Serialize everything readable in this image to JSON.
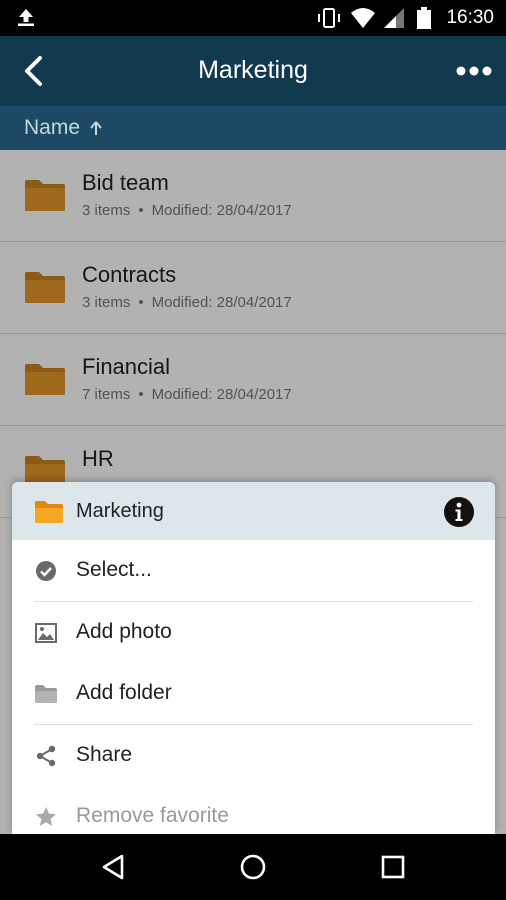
{
  "status_bar": {
    "time": "16:30",
    "icons": [
      "upload-icon",
      "vibrate-icon",
      "wifi-icon",
      "signal-icon",
      "battery-icon"
    ]
  },
  "app_bar": {
    "title": "Marketing",
    "back_icon": "chevron-left-icon",
    "more_icon": "more-horizontal-icon"
  },
  "sort_bar": {
    "label": "Name",
    "direction_icon": "arrow-up-icon"
  },
  "folders": [
    {
      "name": "Bid team",
      "count": "3 items",
      "modified": "Modified: 28/04/2017"
    },
    {
      "name": "Contracts",
      "count": "3 items",
      "modified": "Modified: 28/04/2017"
    },
    {
      "name": "Financial",
      "count": "7 items",
      "modified": "Modified: 28/04/2017"
    },
    {
      "name": "HR",
      "count": "",
      "modified": ""
    }
  ],
  "sheet": {
    "title": "Marketing",
    "items": [
      {
        "label": "Select...",
        "icon": "check-circle-icon"
      },
      {
        "label": "Add photo",
        "icon": "image-icon"
      },
      {
        "label": "Add folder",
        "icon": "folder-icon"
      },
      {
        "label": "Share",
        "icon": "share-icon"
      },
      {
        "label": "Remove favorite",
        "icon": "star-icon"
      }
    ]
  },
  "colors": {
    "app_bar": "#113a4e",
    "sort_bar": "#1c4a64",
    "folder": "#c8811e",
    "sheet_header": "#dde6ea"
  }
}
